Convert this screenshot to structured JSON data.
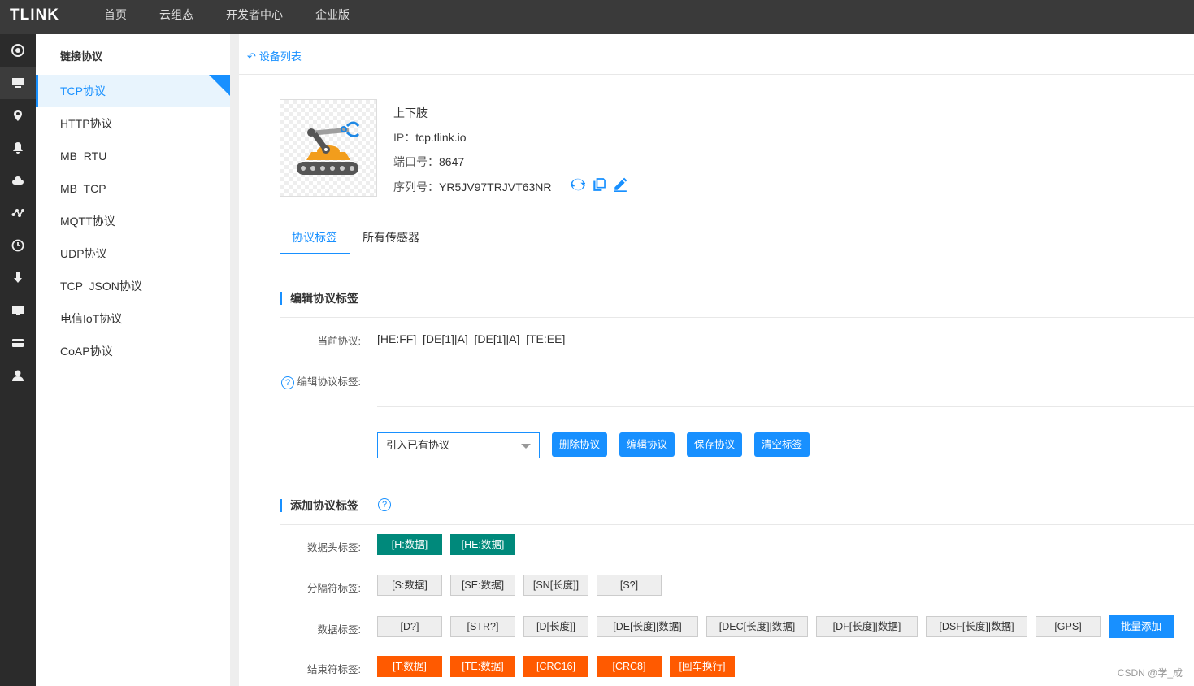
{
  "topbar": {
    "logo": "TLINK",
    "nav": [
      "首页",
      "云组态",
      "开发者中心",
      "企业版"
    ]
  },
  "rail": [
    "target-icon",
    "monitor-icon",
    "location-icon",
    "bell-icon",
    "cloud-icon",
    "share-icon",
    "clock-icon",
    "download-icon",
    "screen-icon",
    "card-icon",
    "user-icon"
  ],
  "sidebar": {
    "title": "链接协议",
    "items": [
      "TCP协议",
      "HTTP协议",
      "MB  RTU",
      "MB  TCP",
      "MQTT协议",
      "UDP协议",
      "TCP  JSON协议",
      "电信IoT协议",
      "CoAP协议"
    ],
    "active_index": 0
  },
  "back": {
    "label": "设备列表"
  },
  "device": {
    "name": "上下肢",
    "ip_label": "IP：",
    "ip": "tcp.tlink.io",
    "port_label": "端口号：",
    "port": "8647",
    "serial_label": "序列号：",
    "serial": "YR5JV97TRJVT63NR"
  },
  "tabs": [
    "协议标签",
    "所有传感器"
  ],
  "edit_section": {
    "title": "编辑协议标签",
    "current_label": "当前协议:",
    "current_value": "[HE:FF]  [DE[1]|A]  [DE[1]|A]  [TE:EE]",
    "edit_label": "编辑协议标签:",
    "select_value": "引入已有协议",
    "buttons": [
      "删除协议",
      "编辑协议",
      "保存协议",
      "清空标签"
    ]
  },
  "add_section": {
    "title": "添加协议标签",
    "rows": [
      {
        "label": "数据头标签:",
        "tags": [
          "[H:数据]",
          "[HE:数据]"
        ]
      },
      {
        "label": "分隔符标签:",
        "tags": [
          "[S:数据]",
          "[SE:数据]",
          "[SN[长度]]",
          "[S?]"
        ]
      },
      {
        "label": "数据标签:",
        "tags": [
          "[D?]",
          "[STR?]",
          "[D[长度]]",
          "[DE[长度]|数据]",
          "[DEC[长度]|数据]",
          "[DF[长度]|数据]",
          "[DSF[长度]|数据]",
          "[GPS]"
        ],
        "extra_button": "批量添加"
      },
      {
        "label": "结束符标签:",
        "tags": [
          "[T:数据]",
          "[TE:数据]",
          "[CRC16]",
          "[CRC8]",
          "[回车换行]"
        ]
      }
    ]
  },
  "watermark": "CSDN @学_成",
  "colors": {
    "primary": "#1890ff",
    "teal": "#00897b",
    "orange": "#ff5a00",
    "topbar": "#3a3a3a",
    "rail": "#2b2b2b"
  }
}
